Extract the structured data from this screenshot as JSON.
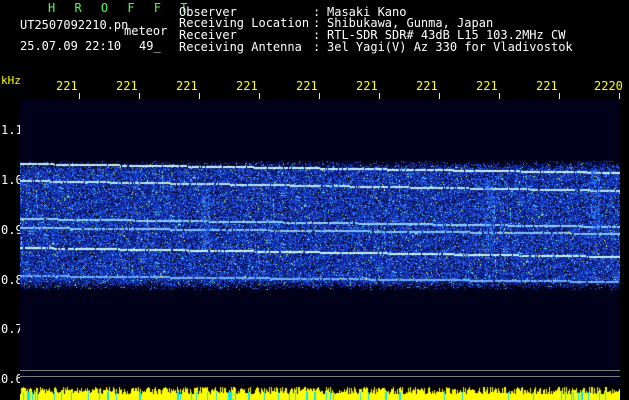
{
  "header": {
    "app_name": "H R O F F T",
    "file_name": "UT2507092210.pn",
    "mode": "meteor",
    "datetime": "25.07.09 22:10",
    "counter": "49_"
  },
  "info": {
    "labels": [
      "Observer",
      "Receiving Location",
      "Receiver",
      "Receiving Antenna"
    ],
    "separators": [
      ":",
      ":",
      ":",
      ":"
    ],
    "values": [
      "Masaki Kano",
      "Shibukawa, Gunma, Japan",
      "RTL-SDR SDR# 43dB L15 103.2MHz CW",
      "3el Yagi(V) Az 330 for Vladivostok"
    ]
  },
  "time_axis": {
    "labels": [
      "221",
      "221",
      "221",
      "221",
      "221",
      "221",
      "221",
      "221",
      "221",
      "2220"
    ]
  },
  "freq_axis": {
    "unit": "kHz",
    "labels": [
      "1.1",
      "1.0",
      "0.9",
      "0.8",
      "0.7",
      "0.6"
    ]
  },
  "colors": {
    "background": "#000000",
    "header_green": "#4dff4d",
    "axis_yellow": "#ffff00",
    "text_white": "#ffffff",
    "spectrum_bg": "#0a0a6e",
    "carrier": "#9fd4ff"
  }
}
